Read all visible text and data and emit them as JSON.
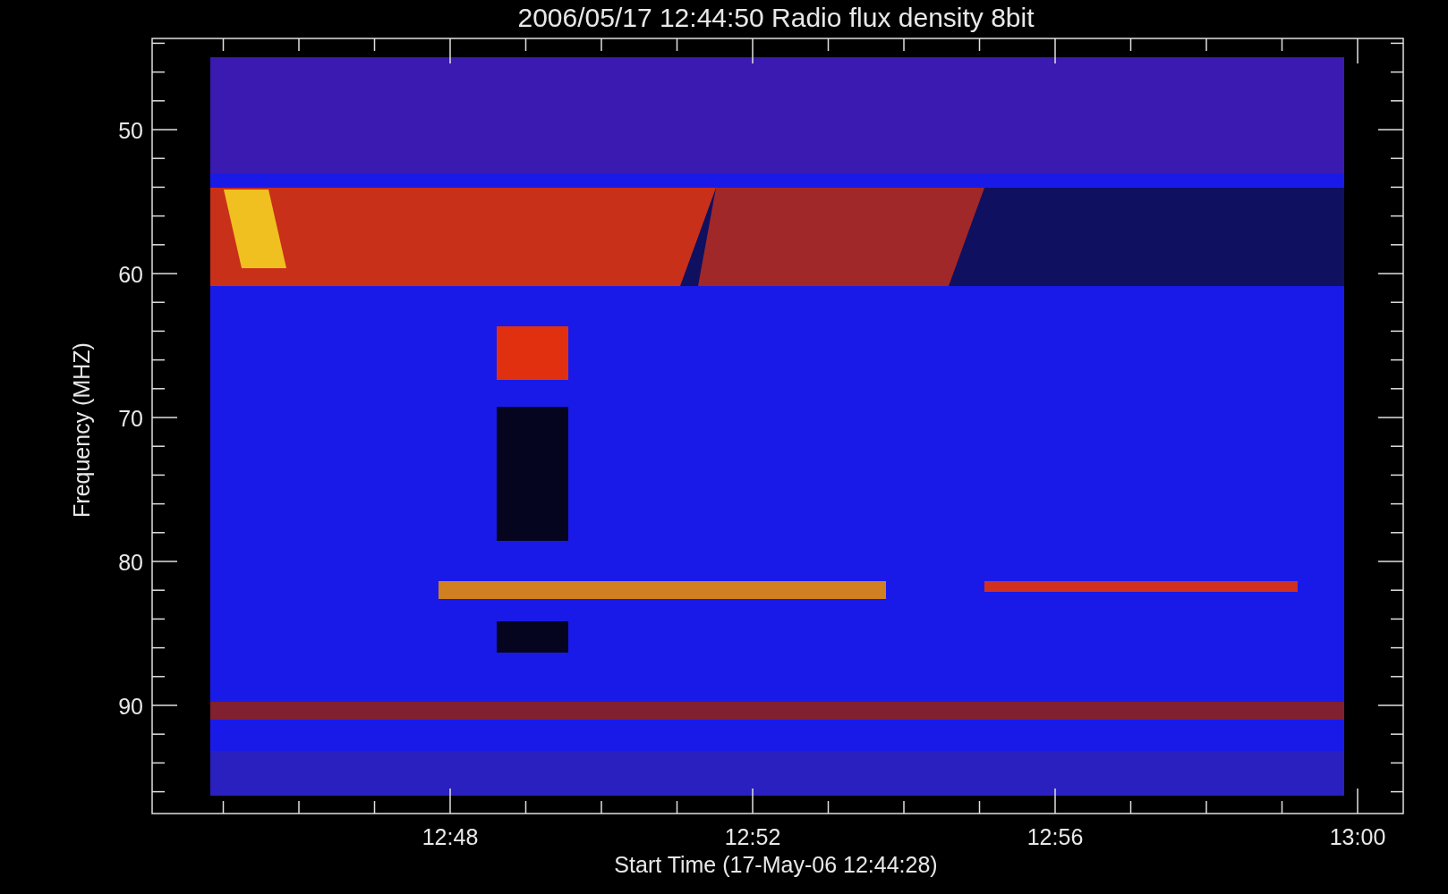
{
  "plot": {
    "title": "2006/05/17 12:44:50 Radio flux density 8bit",
    "ylabel": "Frequency (MHZ)",
    "xlabel": "Start Time (17-May-06 12:44:28)",
    "yticks": [
      "50",
      "60",
      "70",
      "80",
      "90"
    ],
    "xticks": [
      "12:48",
      "12:52",
      "12:56",
      "13:00"
    ]
  }
}
